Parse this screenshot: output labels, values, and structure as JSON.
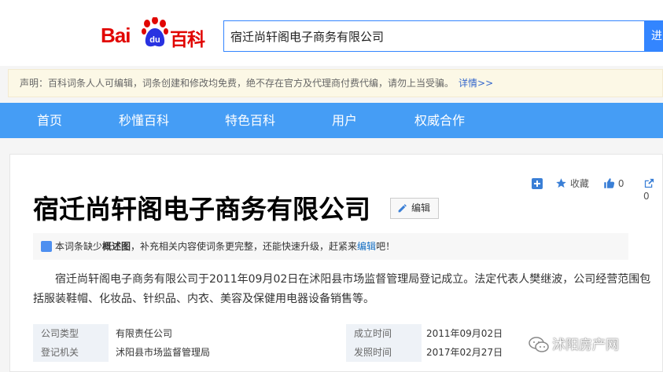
{
  "logo": {
    "text_latin": "Bai",
    "text_du": "du",
    "text_cn": "百科"
  },
  "search": {
    "value": "宿迁尚轩阁电子商务有限公司",
    "button_label": "进"
  },
  "notice": {
    "text": "声明：百科词条人人可编辑，词条创建和修改均免费，绝不存在官方及代理商付费代编，请勿上当受骗。",
    "link": "详情>>"
  },
  "nav": {
    "items": [
      "首页",
      "秒懂百科",
      "特色百科",
      "用户",
      "权威合作"
    ]
  },
  "tools": {
    "collect": "收藏",
    "like_count": "0",
    "share_count": "0"
  },
  "entry": {
    "title": "宿迁尚轩阁电子商务有限公司",
    "edit_label": "编辑",
    "tip_pre": "本词条缺少",
    "tip_bold": "概述图",
    "tip_mid": "，补充相关内容使词条更完整，还能快速升级，赶紧来",
    "tip_link": "编辑",
    "tip_end": "吧！",
    "summary": "宿迁尚轩阁电子商务有限公司于2011年09月02日在沭阳县市场监督管理局登记成立。法定代表人樊继波，公司经营范围包括服装鞋帽、化妆品、针织品、内衣、美容及保健用电器设备销售等。"
  },
  "info_table": {
    "rows": [
      {
        "k1": "公司类型",
        "v1": "有限责任公司",
        "k2": "成立时间",
        "v2": "2011年09月02日"
      },
      {
        "k1": "登记机关",
        "v1": "沭阳县市场监督管理局",
        "k2": "发照时间",
        "v2": "2017年02月27日"
      }
    ]
  },
  "watermark": {
    "text": "沭阳房产网"
  },
  "colors": {
    "brand_red": "#e10602",
    "nav_blue": "#459df5",
    "link_blue": "#136ec2"
  }
}
